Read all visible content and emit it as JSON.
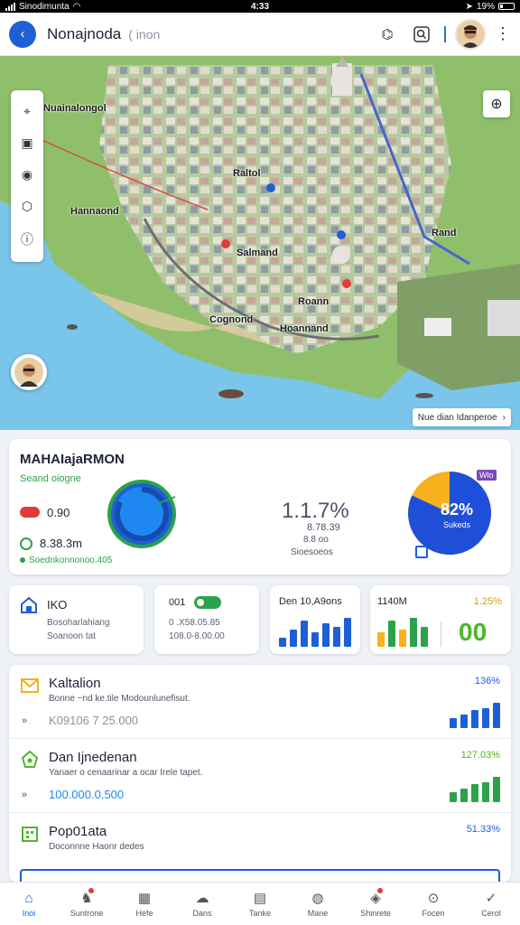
{
  "status_bar": {
    "carrier": "Sinodimunta",
    "time": "4:33",
    "battery": "19%"
  },
  "header": {
    "title": "Nonajnoda",
    "subtitle": "( inon"
  },
  "map": {
    "labels": [
      "Nuainalongol",
      "Raltol",
      "Hannaond",
      "Salmand",
      "Rand",
      "Roann",
      "Hoannand",
      "Cognond"
    ],
    "attribution": "Nue dian Idanperoe"
  },
  "summary": {
    "title": "MAHAIajaRMON",
    "subtitle": "Seand oiogne",
    "value_red": "0.90",
    "value_green": "8.38.3m",
    "link": "Soednkonnonoo.405",
    "donut_left_pct": 0.83,
    "mid_value": "1.1.7%",
    "mid_line1": "8.78.39",
    "mid_line2": "8.8 oo",
    "mid_line3": "Sioesoeos",
    "donut_right_pct": 0.82,
    "donut_right_label": "82%",
    "donut_right_sub": "Sukeds",
    "tag": "Wlo",
    "colors": {
      "blue": "#1f5fd6",
      "green": "#2aa34a",
      "yellow": "#f5b21c",
      "red": "#e03b3b"
    }
  },
  "mini_cards": [
    {
      "title": "IKO",
      "line1": "Bosoharlahiang",
      "line2": "Soanoon tat"
    },
    {
      "title": "001",
      "line1": "0 .X58.05.85",
      "line2": "108.0-8.00.00"
    },
    {
      "title": "Den 10,A9ons",
      "bars": [
        0.3,
        0.6,
        0.9,
        0.5,
        0.8,
        0.7,
        1.0
      ]
    },
    {
      "title": "1140M",
      "pct": "1.25%",
      "big": "00",
      "bars": [
        0.5,
        0.9,
        0.6,
        1.0,
        0.7
      ]
    }
  ],
  "list": [
    {
      "title": "Kaltalion",
      "desc": "Bonne ~nd ke.tile Modounlunefisut.",
      "value": "K09106 7 25.000",
      "pct": "136%",
      "bars": [
        0.4,
        0.55,
        0.7,
        0.8,
        1.0
      ]
    },
    {
      "title": "Dan Ijnedenan",
      "desc": "Yanaer o cenaarinar a ocar Irele tapet.",
      "value": "100.000.0.500",
      "pct": "127.03%",
      "bars": [
        0.4,
        0.55,
        0.7,
        0.8,
        1.0
      ]
    },
    {
      "title": "Pop01ata",
      "desc": "Doconnne Haonr dedes",
      "value": "",
      "pct": "51.33%",
      "bars": []
    }
  ],
  "bottom_nav": [
    {
      "label": "Inoi",
      "icon": "home-icon",
      "active": true
    },
    {
      "label": "Suntrone",
      "icon": "bell-icon",
      "active": false
    },
    {
      "label": "Hefe",
      "icon": "calendar-icon",
      "active": false
    },
    {
      "label": "Dans",
      "icon": "cloud-icon",
      "active": false
    },
    {
      "label": "Tanke",
      "icon": "document-icon",
      "active": false
    },
    {
      "label": "Mane",
      "icon": "globe-icon",
      "active": false
    },
    {
      "label": "Shinrete",
      "icon": "chat-icon",
      "active": false
    },
    {
      "label": "Focen",
      "icon": "search-icon",
      "active": false
    },
    {
      "label": "Cerol",
      "icon": "check-icon",
      "active": false
    }
  ]
}
